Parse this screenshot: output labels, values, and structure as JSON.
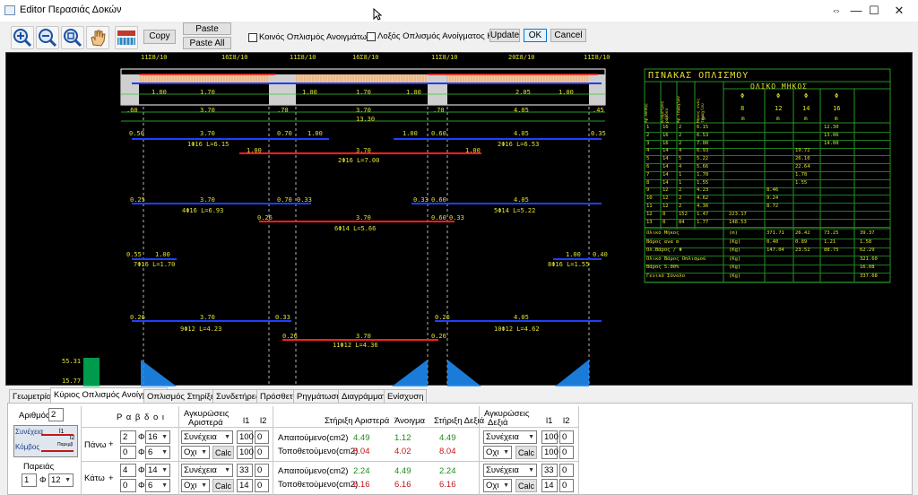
{
  "window": {
    "title": "Editor Περασιάς Δοκών",
    "restore_glyph": "⇔",
    "minimize_glyph": "—",
    "maximize_glyph": "☐",
    "close_glyph": "✕"
  },
  "toolbar": {
    "icons": [
      "zoom-in-icon",
      "zoom-out-icon",
      "zoom-fit-icon",
      "pan-hand-icon",
      "beam-view-icon"
    ],
    "copy_label": "Copy",
    "paste_label": "Paste",
    "paste_all_label": "Paste All",
    "common_top_label": "Κοινός Οπλισμός Ανοιγμάτων",
    "diag_bottom_label": "Λοξός Οπλισμός Ανοίγματος Κάτω",
    "update_label": "Update",
    "ok_label": "OK",
    "cancel_label": "Cancel"
  },
  "drawing": {
    "top_labels": [
      "11Σ8/10",
      "16Σ8/10",
      "11Σ8/10",
      "16Σ8/10",
      "11Σ8/10",
      "20Σ8/10",
      "11Σ8/10"
    ],
    "dim_row1": [
      "1.00",
      "1.70",
      "1.00",
      "1.70",
      "1.00",
      "2.05",
      "1.00"
    ],
    "dim_row2": [
      ".60",
      "3.70",
      ".70",
      "3.70",
      ".70",
      "4.05",
      ".45"
    ],
    "total_length": "13.30",
    "bars": [
      {
        "id": "1",
        "text": "1Φ16 L=6.15",
        "left_dim": "0.50",
        "mid_dim": "3.70",
        "right_dim1": "0.70",
        "right_dim2": "1.00"
      },
      {
        "id": "2",
        "text": "2Φ16 L=6.53",
        "left_dim": "1.00",
        "left_dim2": "0.60",
        "mid_dim": "4.05",
        "right_dim": "0.35"
      },
      {
        "id": "3",
        "text": "2Φ16 L=7.00",
        "left_dim": "1.00",
        "mid_dim": "3.70",
        "right_dim": "1.00"
      },
      {
        "id": "4",
        "text": "4Φ16 L=6.93",
        "left_dim": "0.25",
        "mid_dim": "3.70",
        "right_dim1": "0.70",
        "right_dim2": "0.33"
      },
      {
        "id": "5",
        "text": "5Φ14 L=5.22",
        "left_dim": "0.33",
        "left_dim2": "0.60",
        "mid_dim": "4.05"
      },
      {
        "id": "6",
        "text": "6Φ14 L=5.66",
        "left_dim": "0.26",
        "mid_dim": "3.70",
        "right_dim1": "0.60",
        "right_dim2": "0.33"
      },
      {
        "id": "7",
        "text": "7Φ16 L=1.70",
        "left_dim": "0.55",
        "mid_dim": "1.00"
      },
      {
        "id": "8",
        "text": "8Φ16 L=1.55",
        "mid_dim": "1.00",
        "right_dim": "0.40"
      },
      {
        "id": "9",
        "text": "9Φ12 L=4.23",
        "left_dim": "0.26",
        "mid_dim": "3.70",
        "right_dim": "0.33"
      },
      {
        "id": "10",
        "text": "10Φ12 L=4.62",
        "left_dim": "0.26",
        "mid_dim": "4.05"
      },
      {
        "id": "11",
        "text": "11Φ12 L=4.36",
        "left_dim": "0.26",
        "mid_dim": "3.70",
        "right_dim": "0.26"
      }
    ],
    "legend_values": [
      "55.31",
      "15.77"
    ]
  },
  "schedule": {
    "title": "ΠΙΝΑΚΑΣ ΟΠΛΙΣΜΟΥ",
    "subtitle": "ΟΛΙΚΟ ΜΗΚΟΣ",
    "col_headers": [
      "Αρ.Θέσης",
      "Διάμετρος ράβδου",
      "Αρ.Τεμαχίων",
      "Μήκος ενός τεμαχίου"
    ],
    "phi": [
      "Φ",
      "Φ",
      "Φ",
      "Φ"
    ],
    "diameters": [
      "8",
      "12",
      "14",
      "16"
    ],
    "units": [
      "m",
      "m",
      "m",
      "m",
      "m",
      "m"
    ],
    "rows": [
      [
        "1",
        "16",
        "2",
        "6.15",
        "",
        "",
        "",
        "12.30"
      ],
      [
        "2",
        "16",
        "2",
        "6.53",
        "",
        "",
        "",
        "13.06"
      ],
      [
        "3",
        "16",
        "2",
        "7.00",
        "",
        "",
        "",
        "14.00"
      ],
      [
        "4",
        "14",
        "4",
        "6.93",
        "",
        "",
        "19.72",
        ""
      ],
      [
        "5",
        "14",
        "5",
        "5.22",
        "",
        "",
        "26.10",
        ""
      ],
      [
        "6",
        "14",
        "4",
        "5.66",
        "",
        "",
        "22.64",
        ""
      ],
      [
        "7",
        "14",
        "1",
        "1.70",
        "",
        "",
        "1.70",
        ""
      ],
      [
        "8",
        "14",
        "1",
        "1.55",
        "",
        "",
        "1.55",
        ""
      ],
      [
        "9",
        "12",
        "2",
        "4.23",
        "",
        "8.46",
        "",
        ""
      ],
      [
        "10",
        "12",
        "2",
        "4.62",
        "",
        "9.24",
        "",
        ""
      ],
      [
        "11",
        "12",
        "2",
        "4.36",
        "",
        "8.72",
        "",
        ""
      ],
      [
        "12",
        "8",
        "152",
        "1.47",
        "223.17",
        "",
        "",
        ""
      ],
      [
        "13",
        "8",
        "84",
        "1.77",
        "148.53",
        "",
        "",
        ""
      ]
    ],
    "summary": [
      {
        "label": "Ολικό Μήκος",
        "unit": "(m)",
        "vals": [
          "371.71",
          "26.42",
          "73.25",
          "39.37"
        ]
      },
      {
        "label": "Βάρος ανα m",
        "unit": "(Kg)",
        "vals": [
          "0.40",
          "0.89",
          "1.21",
          "1.58"
        ]
      },
      {
        "label": "Ολ.Βάρος / Φ",
        "unit": "(Kg)",
        "vals": [
          "147.04",
          "23.52",
          "88.75",
          "62.29"
        ]
      },
      {
        "label": "Ολικό Βάρος Οπλισμού",
        "unit": "(Kg)",
        "vals": [
          "",
          "",
          "",
          "321.60"
        ]
      },
      {
        "label": "Βάρος 5.00%",
        "unit": "(Kg)",
        "vals": [
          "",
          "",
          "",
          "16.08"
        ]
      },
      {
        "label": "Γενικό Σύνολο",
        "unit": "(Kg)",
        "vals": [
          "",
          "",
          "",
          "337.68"
        ]
      }
    ]
  },
  "tabs": [
    "Γεωμετρία",
    "Κύριος Οπλισμός Ανοίγματος",
    "Οπλισμός Στηρίξεων",
    "Συνδετήρες",
    "Πρόσθετα",
    "Ρηγμάτωση",
    "Διαγράμματα",
    "Ενίσχυση"
  ],
  "panel": {
    "arithmos_label": "Αριθμός",
    "arithmos_value": "2",
    "synecheia_label": "Συνέχεια",
    "komvos_label": "Κόμβος",
    "paremva_small": "Παρεμβ",
    "l1_label": "l1",
    "l2_label": "l2",
    "pareies_label": "Παρειάς",
    "pareies_count": "1",
    "pareies_phi": "Φ",
    "pareies_diam": "12",
    "rabdoi_header": "Ρ α β δ ο ι",
    "agk_left_header1": "Αγκυρώσεις",
    "agk_left_header2": "Αριστερά",
    "agk_right_header1": "Αγκυρώσεις",
    "agk_right_header2": "Δεξιά",
    "l1_header": "l1",
    "l2_header": "l2",
    "stirixi_left": "Στήριξη Αριστερά",
    "anoigma": "Άνοιγμα",
    "stirixi_right": "Στήριξη Δεξιά",
    "pano_label": "Πάνω",
    "kato_label": "Κάτω",
    "plus": "+",
    "phi": "Φ",
    "top": {
      "r1_count": "2",
      "r1_diam": "16",
      "r1_anch": "Συνέχεια",
      "r1_l1": "100",
      "r1_l2": "0",
      "r2_count": "0",
      "r2_diam": "6",
      "r2_anch": "Οχι",
      "r2_calc": "Calc",
      "r2_l1": "100",
      "r2_l2": "0",
      "req_label": "Απαιτούμενο(cm2)",
      "req": [
        "4.49",
        "1.12",
        "4.49"
      ],
      "placed_label": "Τοποθετούμενο(cm2)",
      "placed": [
        "8.04",
        "4.02",
        "8.04"
      ],
      "right_anch1": "Συνέχεια",
      "right_l1_1": "100",
      "right_l2_1": "0",
      "right_anch2": "Οχι",
      "right_calc": "Calc",
      "right_l1_2": "100",
      "right_l2_2": "0"
    },
    "bottom": {
      "r1_count": "4",
      "r1_diam": "14",
      "r1_anch": "Συνέχεια",
      "r1_l1": "33",
      "r1_l2": "0",
      "r2_count": "0",
      "r2_diam": "6",
      "r2_anch": "Οχι",
      "r2_calc": "Calc",
      "r2_l1": "14",
      "r2_l2": "0",
      "req_label": "Απαιτούμενο(cm2)",
      "req": [
        "2.24",
        "4.49",
        "2.24"
      ],
      "placed_label": "Τοποθετούμενο(cm2)",
      "placed": [
        "6.16",
        "6.16",
        "6.16"
      ],
      "right_anch1": "Συνέχεια",
      "right_l1_1": "33",
      "right_l2_1": "0",
      "right_anch2": "Οχι",
      "right_calc": "Calc",
      "right_l1_2": "14",
      "right_l2_2": "0"
    }
  }
}
